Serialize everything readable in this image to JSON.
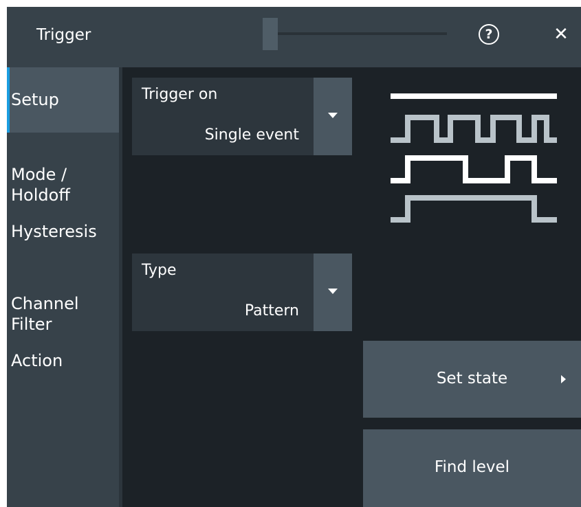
{
  "window": {
    "title": "Trigger"
  },
  "titlebar": {
    "help_icon_glyph": "?",
    "close_icon_glyph": "✕"
  },
  "sidebar": {
    "items": [
      {
        "label": "Setup",
        "active": true
      },
      {
        "label": "Mode /\nHoldoff",
        "active": false
      },
      {
        "label": "Hysteresis",
        "active": false
      },
      {
        "label": "Channel\nFilter",
        "active": false
      },
      {
        "label": "Action",
        "active": false
      }
    ]
  },
  "trigger_on": {
    "label": "Trigger on",
    "value": "Single event"
  },
  "type": {
    "label": "Type",
    "value": "Pattern"
  },
  "buttons": {
    "set_state": "Set state",
    "find_level": "Find level"
  },
  "colors": {
    "background": "#1c2227",
    "panel": "#37424a",
    "button": "#4a5761",
    "accent": "#1a9de0",
    "signal_white": "#ffffff",
    "signal_gray": "#b9c3c9"
  },
  "icons": [
    "help-icon",
    "close-icon",
    "dropdown-caret-icon",
    "chevron-right-icon",
    "pattern-waveform-icon"
  ]
}
